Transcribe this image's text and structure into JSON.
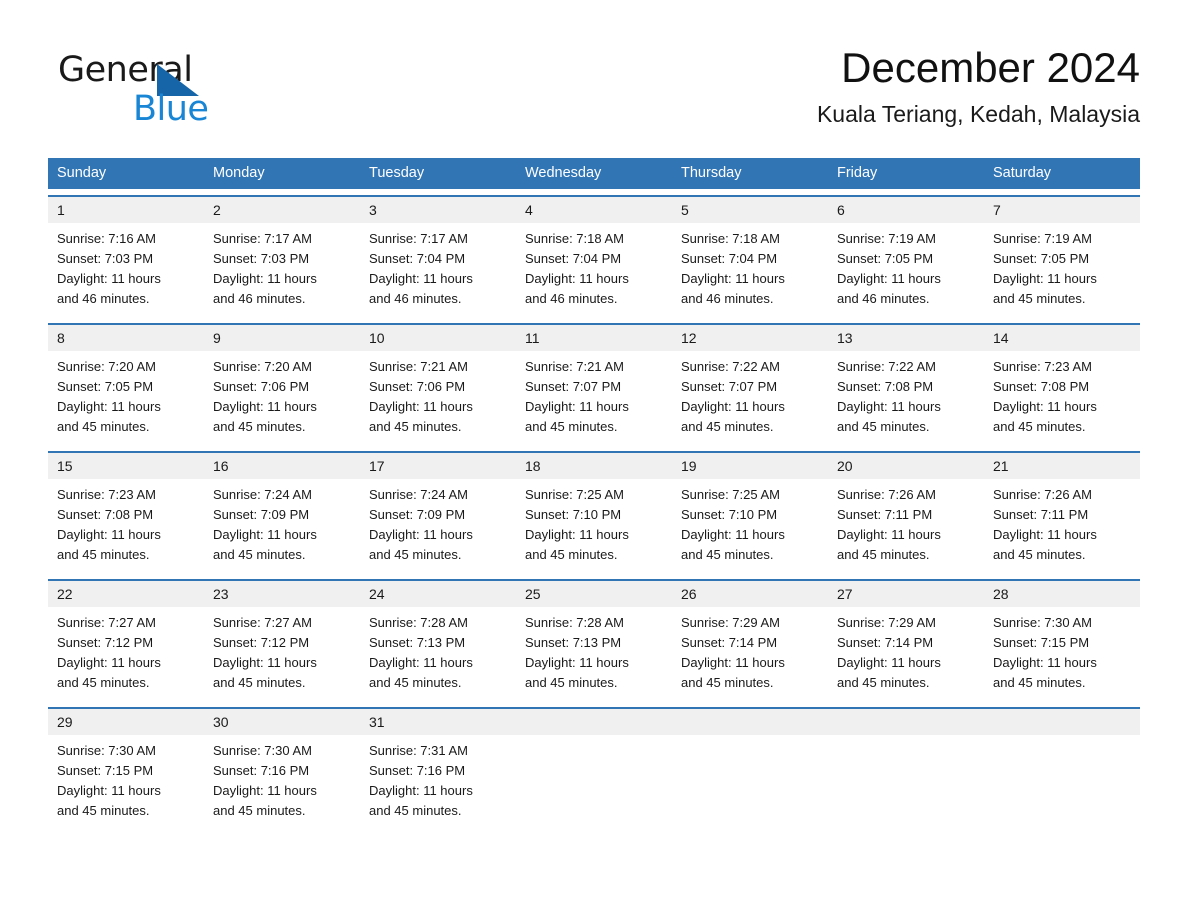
{
  "brand": {
    "name_part1": "General",
    "name_part2": "Blue",
    "triangle_color": "#1565a8",
    "blue_text_color": "#1886d4"
  },
  "header": {
    "month_title": "December 2024",
    "location": "Kuala Teriang, Kedah, Malaysia"
  },
  "theme": {
    "header_blue": "#3175b5",
    "daynum_band_gray": "#f0f0f0",
    "text_color": "#1a1a1a"
  },
  "calendar": {
    "weekdays": [
      "Sunday",
      "Monday",
      "Tuesday",
      "Wednesday",
      "Thursday",
      "Friday",
      "Saturday"
    ],
    "weeks": [
      {
        "days": [
          {
            "num": "1",
            "sunrise": "Sunrise: 7:16 AM",
            "sunset": "Sunset: 7:03 PM",
            "daylight1": "Daylight: 11 hours",
            "daylight2": "and 46 minutes."
          },
          {
            "num": "2",
            "sunrise": "Sunrise: 7:17 AM",
            "sunset": "Sunset: 7:03 PM",
            "daylight1": "Daylight: 11 hours",
            "daylight2": "and 46 minutes."
          },
          {
            "num": "3",
            "sunrise": "Sunrise: 7:17 AM",
            "sunset": "Sunset: 7:04 PM",
            "daylight1": "Daylight: 11 hours",
            "daylight2": "and 46 minutes."
          },
          {
            "num": "4",
            "sunrise": "Sunrise: 7:18 AM",
            "sunset": "Sunset: 7:04 PM",
            "daylight1": "Daylight: 11 hours",
            "daylight2": "and 46 minutes."
          },
          {
            "num": "5",
            "sunrise": "Sunrise: 7:18 AM",
            "sunset": "Sunset: 7:04 PM",
            "daylight1": "Daylight: 11 hours",
            "daylight2": "and 46 minutes."
          },
          {
            "num": "6",
            "sunrise": "Sunrise: 7:19 AM",
            "sunset": "Sunset: 7:05 PM",
            "daylight1": "Daylight: 11 hours",
            "daylight2": "and 46 minutes."
          },
          {
            "num": "7",
            "sunrise": "Sunrise: 7:19 AM",
            "sunset": "Sunset: 7:05 PM",
            "daylight1": "Daylight: 11 hours",
            "daylight2": "and 45 minutes."
          }
        ]
      },
      {
        "days": [
          {
            "num": "8",
            "sunrise": "Sunrise: 7:20 AM",
            "sunset": "Sunset: 7:05 PM",
            "daylight1": "Daylight: 11 hours",
            "daylight2": "and 45 minutes."
          },
          {
            "num": "9",
            "sunrise": "Sunrise: 7:20 AM",
            "sunset": "Sunset: 7:06 PM",
            "daylight1": "Daylight: 11 hours",
            "daylight2": "and 45 minutes."
          },
          {
            "num": "10",
            "sunrise": "Sunrise: 7:21 AM",
            "sunset": "Sunset: 7:06 PM",
            "daylight1": "Daylight: 11 hours",
            "daylight2": "and 45 minutes."
          },
          {
            "num": "11",
            "sunrise": "Sunrise: 7:21 AM",
            "sunset": "Sunset: 7:07 PM",
            "daylight1": "Daylight: 11 hours",
            "daylight2": "and 45 minutes."
          },
          {
            "num": "12",
            "sunrise": "Sunrise: 7:22 AM",
            "sunset": "Sunset: 7:07 PM",
            "daylight1": "Daylight: 11 hours",
            "daylight2": "and 45 minutes."
          },
          {
            "num": "13",
            "sunrise": "Sunrise: 7:22 AM",
            "sunset": "Sunset: 7:08 PM",
            "daylight1": "Daylight: 11 hours",
            "daylight2": "and 45 minutes."
          },
          {
            "num": "14",
            "sunrise": "Sunrise: 7:23 AM",
            "sunset": "Sunset: 7:08 PM",
            "daylight1": "Daylight: 11 hours",
            "daylight2": "and 45 minutes."
          }
        ]
      },
      {
        "days": [
          {
            "num": "15",
            "sunrise": "Sunrise: 7:23 AM",
            "sunset": "Sunset: 7:08 PM",
            "daylight1": "Daylight: 11 hours",
            "daylight2": "and 45 minutes."
          },
          {
            "num": "16",
            "sunrise": "Sunrise: 7:24 AM",
            "sunset": "Sunset: 7:09 PM",
            "daylight1": "Daylight: 11 hours",
            "daylight2": "and 45 minutes."
          },
          {
            "num": "17",
            "sunrise": "Sunrise: 7:24 AM",
            "sunset": "Sunset: 7:09 PM",
            "daylight1": "Daylight: 11 hours",
            "daylight2": "and 45 minutes."
          },
          {
            "num": "18",
            "sunrise": "Sunrise: 7:25 AM",
            "sunset": "Sunset: 7:10 PM",
            "daylight1": "Daylight: 11 hours",
            "daylight2": "and 45 minutes."
          },
          {
            "num": "19",
            "sunrise": "Sunrise: 7:25 AM",
            "sunset": "Sunset: 7:10 PM",
            "daylight1": "Daylight: 11 hours",
            "daylight2": "and 45 minutes."
          },
          {
            "num": "20",
            "sunrise": "Sunrise: 7:26 AM",
            "sunset": "Sunset: 7:11 PM",
            "daylight1": "Daylight: 11 hours",
            "daylight2": "and 45 minutes."
          },
          {
            "num": "21",
            "sunrise": "Sunrise: 7:26 AM",
            "sunset": "Sunset: 7:11 PM",
            "daylight1": "Daylight: 11 hours",
            "daylight2": "and 45 minutes."
          }
        ]
      },
      {
        "days": [
          {
            "num": "22",
            "sunrise": "Sunrise: 7:27 AM",
            "sunset": "Sunset: 7:12 PM",
            "daylight1": "Daylight: 11 hours",
            "daylight2": "and 45 minutes."
          },
          {
            "num": "23",
            "sunrise": "Sunrise: 7:27 AM",
            "sunset": "Sunset: 7:12 PM",
            "daylight1": "Daylight: 11 hours",
            "daylight2": "and 45 minutes."
          },
          {
            "num": "24",
            "sunrise": "Sunrise: 7:28 AM",
            "sunset": "Sunset: 7:13 PM",
            "daylight1": "Daylight: 11 hours",
            "daylight2": "and 45 minutes."
          },
          {
            "num": "25",
            "sunrise": "Sunrise: 7:28 AM",
            "sunset": "Sunset: 7:13 PM",
            "daylight1": "Daylight: 11 hours",
            "daylight2": "and 45 minutes."
          },
          {
            "num": "26",
            "sunrise": "Sunrise: 7:29 AM",
            "sunset": "Sunset: 7:14 PM",
            "daylight1": "Daylight: 11 hours",
            "daylight2": "and 45 minutes."
          },
          {
            "num": "27",
            "sunrise": "Sunrise: 7:29 AM",
            "sunset": "Sunset: 7:14 PM",
            "daylight1": "Daylight: 11 hours",
            "daylight2": "and 45 minutes."
          },
          {
            "num": "28",
            "sunrise": "Sunrise: 7:30 AM",
            "sunset": "Sunset: 7:15 PM",
            "daylight1": "Daylight: 11 hours",
            "daylight2": "and 45 minutes."
          }
        ]
      },
      {
        "days": [
          {
            "num": "29",
            "sunrise": "Sunrise: 7:30 AM",
            "sunset": "Sunset: 7:15 PM",
            "daylight1": "Daylight: 11 hours",
            "daylight2": "and 45 minutes."
          },
          {
            "num": "30",
            "sunrise": "Sunrise: 7:30 AM",
            "sunset": "Sunset: 7:16 PM",
            "daylight1": "Daylight: 11 hours",
            "daylight2": "and 45 minutes."
          },
          {
            "num": "31",
            "sunrise": "Sunrise: 7:31 AM",
            "sunset": "Sunset: 7:16 PM",
            "daylight1": "Daylight: 11 hours",
            "daylight2": "and 45 minutes."
          },
          {
            "num": "",
            "sunrise": "",
            "sunset": "",
            "daylight1": "",
            "daylight2": ""
          },
          {
            "num": "",
            "sunrise": "",
            "sunset": "",
            "daylight1": "",
            "daylight2": ""
          },
          {
            "num": "",
            "sunrise": "",
            "sunset": "",
            "daylight1": "",
            "daylight2": ""
          },
          {
            "num": "",
            "sunrise": "",
            "sunset": "",
            "daylight1": "",
            "daylight2": ""
          }
        ]
      }
    ]
  }
}
